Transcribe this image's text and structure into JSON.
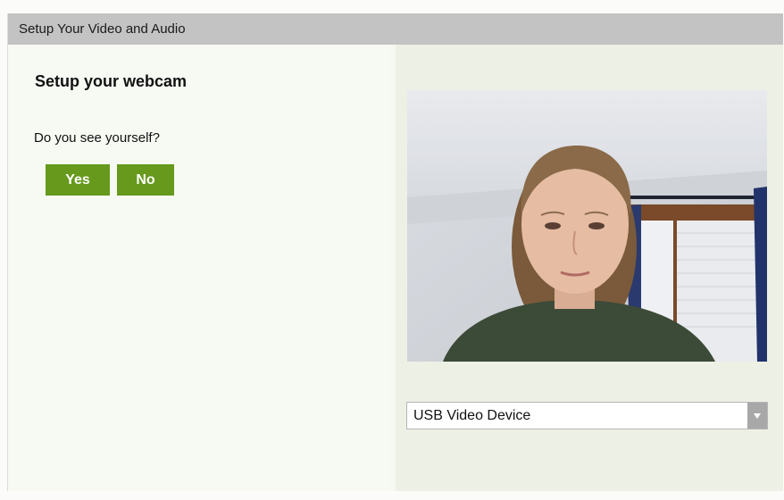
{
  "dialog": {
    "title": "Setup Your Video and Audio"
  },
  "webcam": {
    "heading": "Setup your webcam",
    "question": "Do you see yourself?",
    "yes_label": "Yes",
    "no_label": "No"
  },
  "device_select": {
    "selected": "USB Video Device",
    "arrow_icon": "triangle-down-icon"
  },
  "colors": {
    "accent": "#66991c",
    "titlebar": "#c3c3c3"
  }
}
